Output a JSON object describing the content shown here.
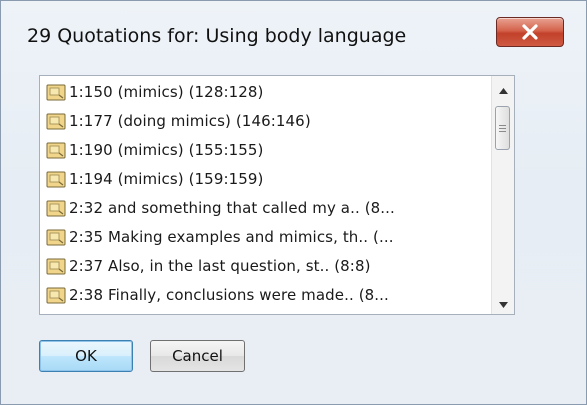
{
  "window": {
    "title": "29 Quotations for: Using body language",
    "close_glyph": "X"
  },
  "list": {
    "items": [
      {
        "text": "1:150 (mimics) (128:128)",
        "icon": "quotation-icon"
      },
      {
        "text": "1:177 (doing mimics) (146:146)",
        "icon": "quotation-icon"
      },
      {
        "text": "1:190 (mimics) (155:155)",
        "icon": "quotation-icon"
      },
      {
        "text": "1:194 (mimics) (159:159)",
        "icon": "quotation-icon"
      },
      {
        "text": "2:32 and something that called my a.. (8...",
        "icon": "quotation-icon"
      },
      {
        "text": "2:35 Making examples and mimics, th.. (...",
        "icon": "quotation-icon"
      },
      {
        "text": "2:37 Also, in the last question, st.. (8:8)",
        "icon": "quotation-icon"
      },
      {
        "text": "2:38 Finally, conclusions were made.. (8...",
        "icon": "quotation-icon"
      }
    ]
  },
  "buttons": {
    "ok_label": "OK",
    "cancel_label": "Cancel"
  },
  "colors": {
    "close_button": "#c2412a",
    "ok_border": "#3c7fb1",
    "icon_fill": "#f0d58a"
  }
}
